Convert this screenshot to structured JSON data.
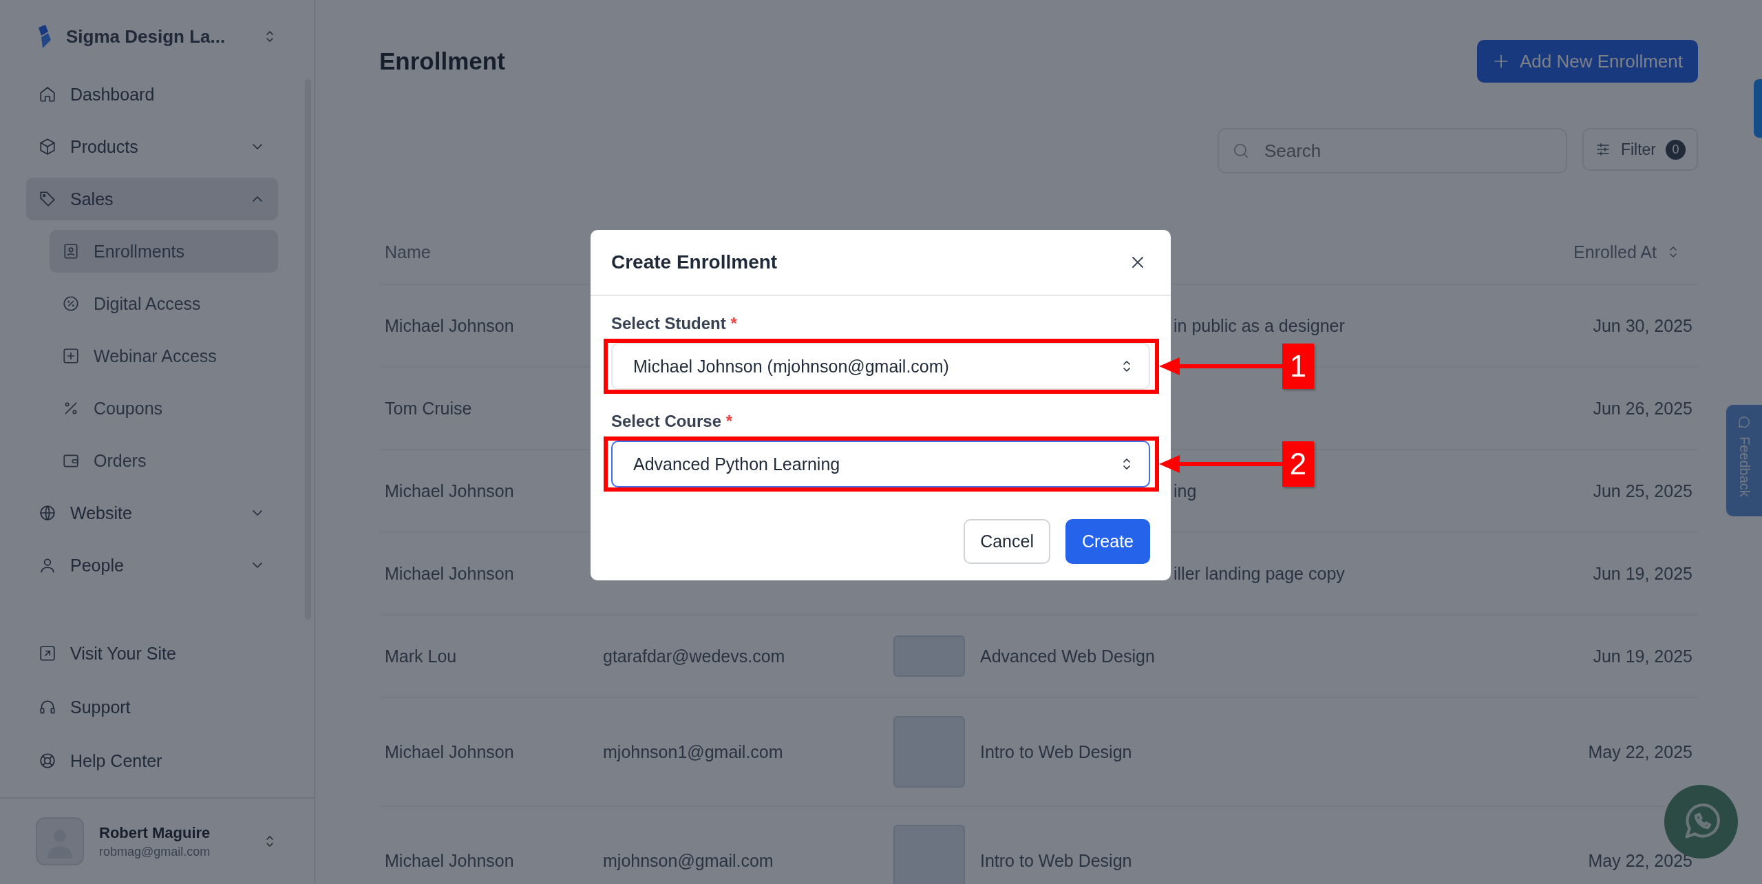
{
  "sidebar": {
    "workspace": "Sigma Design La...",
    "items": [
      {
        "label": "Dashboard",
        "kind": "link",
        "selected": false
      },
      {
        "label": "Products",
        "kind": "group",
        "expanded": false,
        "selected": false
      },
      {
        "label": "Sales",
        "kind": "group",
        "expanded": true,
        "selected": true,
        "children": [
          {
            "label": "Enrollments",
            "selected": true
          },
          {
            "label": "Digital Access",
            "selected": false
          },
          {
            "label": "Webinar Access",
            "selected": false
          },
          {
            "label": "Coupons",
            "selected": false
          },
          {
            "label": "Orders",
            "selected": false
          }
        ]
      },
      {
        "label": "Website",
        "kind": "group",
        "expanded": false,
        "selected": false
      },
      {
        "label": "People",
        "kind": "group",
        "expanded": false,
        "selected": false
      }
    ],
    "footer_links": [
      {
        "label": "Visit Your Site"
      },
      {
        "label": "Support"
      },
      {
        "label": "Help Center"
      }
    ],
    "user": {
      "name": "Robert Maguire",
      "email": "robmag@gmail.com"
    }
  },
  "page": {
    "title": "Enrollment",
    "add_button": "Add New Enrollment",
    "search": {
      "placeholder": "Search"
    },
    "filter": {
      "label": "Filter",
      "count": "0"
    }
  },
  "table": {
    "header": {
      "name": "Name",
      "enrolled_at": "Enrolled At"
    },
    "rows": [
      {
        "kind": "no_thumbnail",
        "name": "Michael Johnson",
        "course_fragment": "in public as a designer",
        "enrolled_at": "Jun 30, 2025"
      },
      {
        "kind": "no_thumbnail",
        "name": "Tom Cruise",
        "enrolled_at": "Jun 26, 2025"
      },
      {
        "kind": "no_thumbnail",
        "name": "Michael Johnson",
        "course_fragment": "ing",
        "enrolled_at": "Jun 25, 2025"
      },
      {
        "kind": "no_thumbnail",
        "name": "Michael Johnson",
        "course_fragment": "iller landing page copy",
        "enrolled_at": "Jun 19, 2025"
      },
      {
        "kind": "wide_thumbnail",
        "name": "Mark Lou",
        "email": "gtarafdar@wedevs.com",
        "course": "Advanced Web Design",
        "enrolled_at": "Jun 19, 2025"
      },
      {
        "kind": "square_thumbnail",
        "name": "Michael Johnson",
        "email": "mjohnson1@gmail.com",
        "course": "Intro to Web Design",
        "enrolled_at": "May 22, 2025"
      },
      {
        "kind": "square_thumbnail",
        "name": "Michael Johnson",
        "email": "mjohnson@gmail.com",
        "course": "Intro to Web Design",
        "enrolled_at": "May 22, 2025"
      }
    ]
  },
  "feedback_tab": "Feedback",
  "dialog": {
    "title": "Create Enrollment",
    "fields": [
      {
        "label": "Select Student",
        "required_mark": "*",
        "value": "Michael Johnson (mjohnson@gmail.com)",
        "focused": false,
        "annotation": "1"
      },
      {
        "label": "Select Course",
        "required_mark": "*",
        "value": "Advanced Python Learning",
        "focused": true,
        "annotation": "2"
      }
    ],
    "buttons": [
      {
        "label": "Cancel",
        "kind": "secondary"
      },
      {
        "label": "Create",
        "kind": "primary"
      }
    ]
  }
}
